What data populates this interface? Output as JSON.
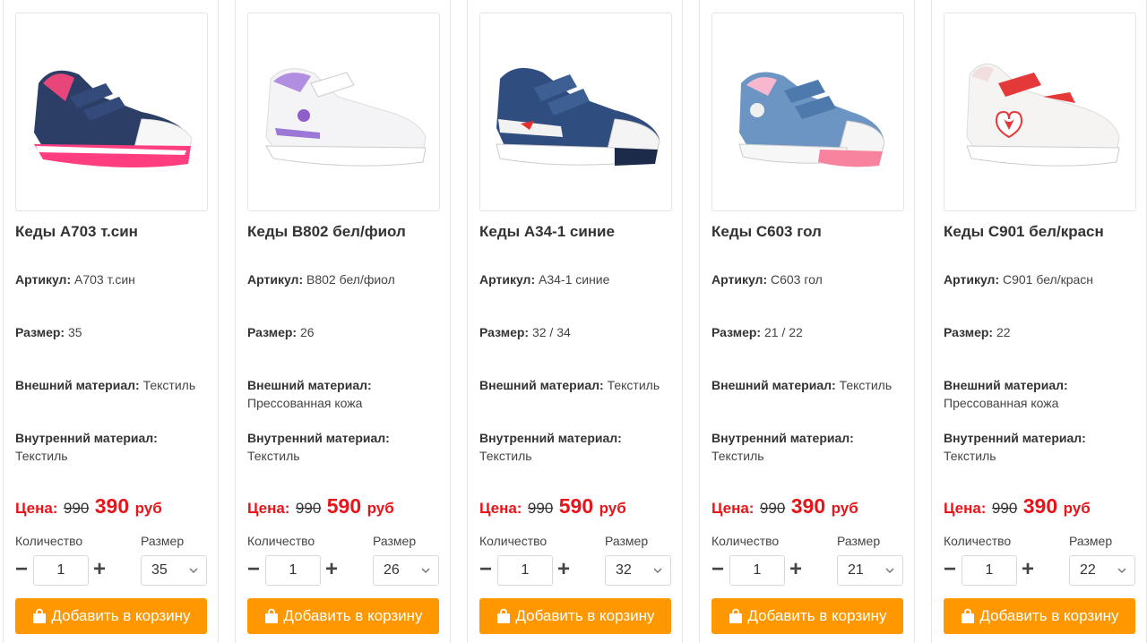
{
  "labels": {
    "article": "Артикул:",
    "size": "Размер:",
    "outer_material": "Внешний материал:",
    "inner_material": "Внутренний материал:",
    "price": "Цена:",
    "currency": "руб",
    "quantity": "Количество",
    "size_select": "Размер",
    "add_to_cart": "Добавить в корзину"
  },
  "colors": {
    "accent_button": "#ff9800",
    "price_red": "#e8141a"
  },
  "products": [
    {
      "title": "Кеды А703 т.син",
      "article": "А703 т.син",
      "size": "35",
      "outer_material": "Текстиль",
      "inner_material": "Текстиль",
      "old_price": "990",
      "new_price": "390",
      "quantity": "1",
      "selected_size": "35",
      "image": "sneaker-denim-pink-icon"
    },
    {
      "title": "Кеды В802 бел/фиол",
      "article": "В802 бел/фиол",
      "size": "26",
      "outer_material": "Прессованная кожа",
      "inner_material": "Текстиль",
      "old_price": "990",
      "new_price": "590",
      "quantity": "1",
      "selected_size": "26",
      "image": "sneaker-white-purple-icon"
    },
    {
      "title": "Кеды А34-1 синие",
      "article": "А34-1 синие",
      "size": "32 / 34",
      "outer_material": "Текстиль",
      "inner_material": "Текстиль",
      "old_price": "990",
      "new_price": "590",
      "quantity": "1",
      "selected_size": "32",
      "image": "sneaker-denim-blue-icon"
    },
    {
      "title": "Кеды С603 гол",
      "article": "С603 гол",
      "size": "21 / 22",
      "outer_material": "Текстиль",
      "inner_material": "Текстиль",
      "old_price": "990",
      "new_price": "390",
      "quantity": "1",
      "selected_size": "21",
      "image": "sneaker-lightblue-pink-icon"
    },
    {
      "title": "Кеды С901 бел/красн",
      "article": "С901 бел/красн",
      "size": "22",
      "outer_material": "Прессованная кожа",
      "inner_material": "Текстиль",
      "old_price": "990",
      "new_price": "390",
      "quantity": "1",
      "selected_size": "22",
      "image": "sneaker-white-red-icon"
    }
  ]
}
